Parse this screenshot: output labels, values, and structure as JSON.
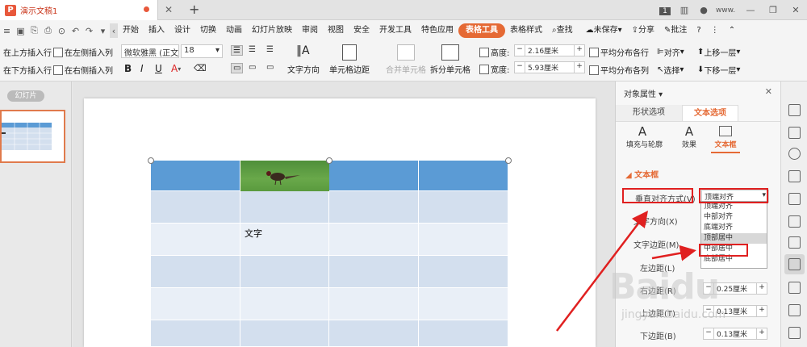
{
  "titlebar": {
    "doc_title": "演示文稿1",
    "page_badge": "1",
    "user": "www."
  },
  "menubar": {
    "quick_icons": [
      "save-icon",
      "export-icon",
      "print-icon",
      "preview-icon",
      "undo-icon",
      "redo-icon",
      "more-icon"
    ],
    "items": [
      "开始",
      "插入",
      "设计",
      "切换",
      "动画",
      "幻灯片放映",
      "审阅",
      "视图",
      "安全",
      "开发工具",
      "特色应用",
      "表格工具",
      "表格样式"
    ],
    "active": "表格工具",
    "search": "查找",
    "unsaved": "未保存",
    "share": "分享",
    "annotate": "批注"
  },
  "ribbon": {
    "insert_above": "在上方插入行",
    "insert_left": "在左侧插入列",
    "insert_below": "在下方插入行",
    "insert_right": "在右侧插入列",
    "font": "微软雅黑 (正文",
    "font_size": "18",
    "text_direction": "文字方向",
    "cell_margin": "单元格边距",
    "merge": "合并单元格",
    "split": "拆分单元格",
    "height_label": "高度:",
    "height_value": "2.16厘米",
    "width_label": "宽度:",
    "width_value": "5.93厘米",
    "distribute_rows": "平均分布各行",
    "distribute_cols": "平均分布各列",
    "align": "对齐",
    "select": "选择",
    "bring_forward": "上移一层",
    "send_backward": "下移一层"
  },
  "leftpane": {
    "slides_label": "幻灯片"
  },
  "slide": {
    "cell_text": "文字"
  },
  "props": {
    "title": "对象属性",
    "tabs": [
      "形状选项",
      "文本选项"
    ],
    "active_tab": "文本选项",
    "subtabs": [
      "填充与轮廓",
      "效果",
      "文本框"
    ],
    "active_subtab": "文本框",
    "section": "文本框",
    "vertical_align_label": "垂直对齐方式(V)",
    "vertical_align_value": "顶端对齐",
    "text_direction_label": "文字方向(X)",
    "margin_label": "文字边距(M)",
    "left_margin_label": "左边距(L)",
    "right_margin_label": "右边距(R)",
    "right_margin_value": "0.25厘米",
    "top_margin_label": "上边距(T)",
    "top_margin_value": "0.13厘米",
    "bottom_margin_label": "下边距(B)",
    "bottom_margin_value": "0.13厘米",
    "options": [
      "顶端对齐",
      "中部对齐",
      "底端对齐",
      "顶部居中",
      "中部居中",
      "底部居中"
    ],
    "hovered_option": "顶部居中",
    "highlighted_option": "中部居中"
  },
  "watermark": {
    "brand": "Baidu",
    "sub": "jingyan.baidu.com"
  },
  "colors": {
    "accent": "#e56a35",
    "table_header": "#5b9bd5",
    "table_body": "#d3dfee",
    "table_body_alt": "#e9eff7",
    "annotation": "#e02020"
  }
}
